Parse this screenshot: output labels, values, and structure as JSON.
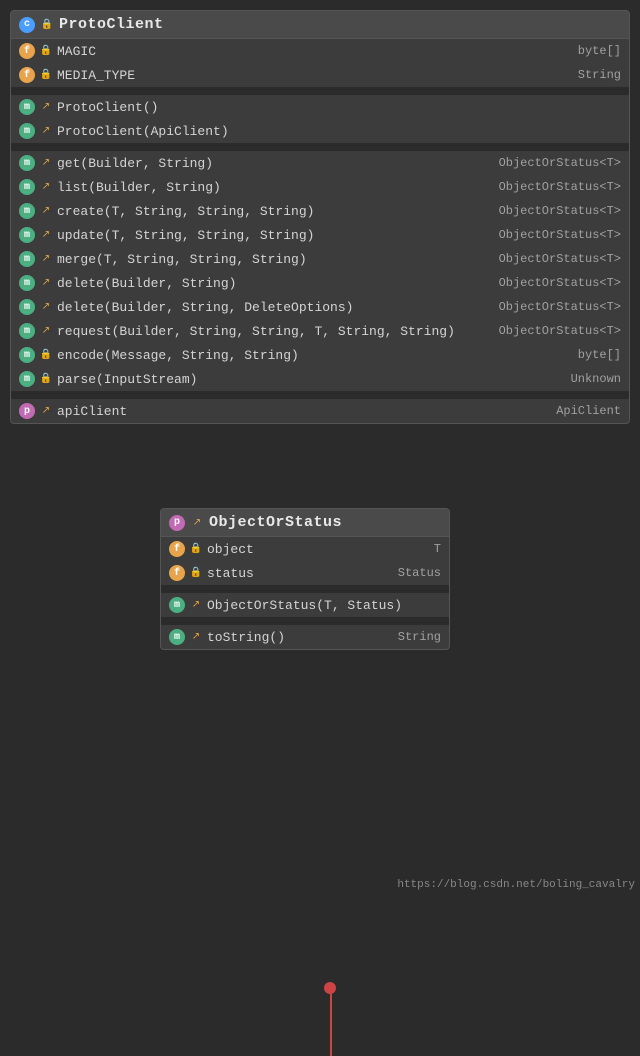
{
  "protoClient": {
    "title": "ProtoClient",
    "fields": [
      {
        "badge": "f",
        "lock": true,
        "name": "MAGIC",
        "type": "byte[]"
      },
      {
        "badge": "f",
        "lock": true,
        "name": "MEDIA_TYPE",
        "type": "String"
      }
    ],
    "constructors": [
      {
        "badge": "m",
        "lock": false,
        "name": "ProtoClient()",
        "type": ""
      },
      {
        "badge": "m",
        "lock": false,
        "name": "ProtoClient(ApiClient)",
        "type": ""
      }
    ],
    "methods": [
      {
        "badge": "m",
        "lock": false,
        "name": "get(Builder, String)",
        "type": "ObjectOrStatus<T>"
      },
      {
        "badge": "m",
        "lock": false,
        "name": "list(Builder, String)",
        "type": "ObjectOrStatus<T>"
      },
      {
        "badge": "m",
        "lock": false,
        "name": "create(T, String, String, String)",
        "type": "ObjectOrStatus<T>"
      },
      {
        "badge": "m",
        "lock": false,
        "name": "update(T, String, String, String)",
        "type": "ObjectOrStatus<T>"
      },
      {
        "badge": "m",
        "lock": false,
        "name": "merge(T, String, String, String)",
        "type": "ObjectOrStatus<T>"
      },
      {
        "badge": "m",
        "lock": false,
        "name": "delete(Builder, String)",
        "type": "ObjectOrStatus<T>"
      },
      {
        "badge": "m",
        "lock": false,
        "name": "delete(Builder, String, DeleteOptions)",
        "type": "ObjectOrStatus<T>"
      },
      {
        "badge": "m",
        "lock": false,
        "name": "request(Builder, String, String, T, String, String)",
        "type": "ObjectOrStatus<T>"
      },
      {
        "badge": "m",
        "lock": true,
        "name": "encode(Message, String, String)",
        "type": "byte[]"
      },
      {
        "badge": "m",
        "lock": true,
        "name": "parse(InputStream)",
        "type": "Unknown"
      }
    ],
    "properties": [
      {
        "badge": "p",
        "lock": false,
        "name": "apiClient",
        "type": "ApiClient"
      }
    ]
  },
  "objectOrStatus": {
    "title": "ObjectOrStatus",
    "fields": [
      {
        "badge": "f",
        "lock": true,
        "name": "object",
        "type": "T"
      },
      {
        "badge": "f",
        "lock": true,
        "name": "status",
        "type": "Status"
      }
    ],
    "constructors": [
      {
        "badge": "m",
        "lock": false,
        "name": "ObjectOrStatus(T, Status)",
        "type": ""
      }
    ],
    "methods": [
      {
        "badge": "m",
        "lock": false,
        "name": "toString()",
        "type": "String"
      }
    ]
  },
  "watermark": "https://blog.csdn.net/boling_cavalry"
}
